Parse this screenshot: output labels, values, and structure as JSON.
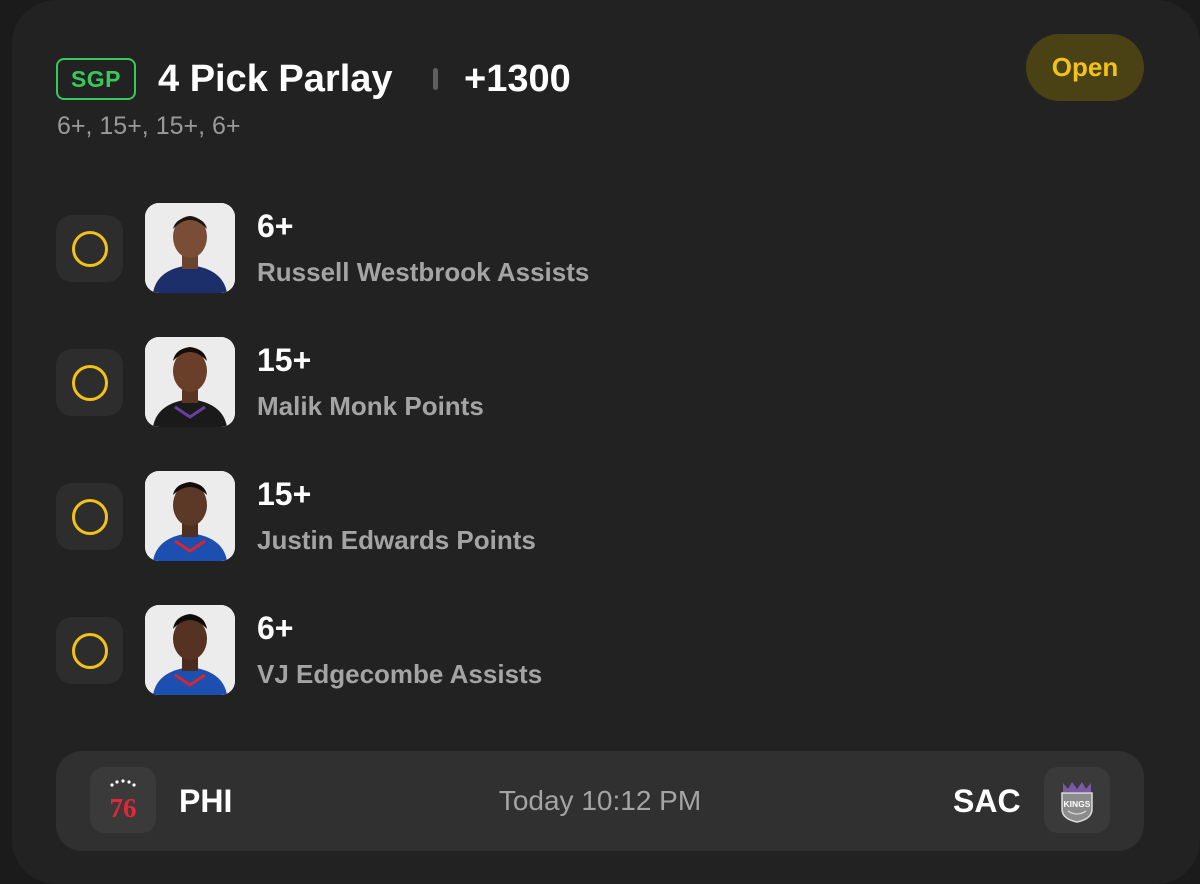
{
  "header": {
    "badge": "SGP",
    "title": "4 Pick Parlay",
    "odds": "+1300",
    "subtitle": "6+, 15+, 15+, 6+",
    "status": "Open"
  },
  "legs": [
    {
      "line": "6+",
      "market": "Russell Westbrook Assists",
      "jersey": "#1d2f6b",
      "avatar": "player-headshot"
    },
    {
      "line": "15+",
      "market": "Malik Monk Points",
      "jersey": "#1a1a1a",
      "avatar": "player-headshot"
    },
    {
      "line": "15+",
      "market": "Justin Edwards Points",
      "jersey": "#1d4fb0",
      "avatar": "player-headshot"
    },
    {
      "line": "6+",
      "market": "VJ Edgecombe Assists",
      "jersey": "#1d4fb0",
      "avatar": "player-headshot"
    }
  ],
  "game": {
    "away": {
      "abbr": "PHI",
      "logo": "76ers-logo",
      "logo_text": "76"
    },
    "time": "Today 10:12 PM",
    "home": {
      "abbr": "SAC",
      "logo": "kings-logo",
      "logo_text": "KINGS"
    }
  },
  "colors": {
    "accent": "#f2c218",
    "sgp_green": "#38c95a",
    "card_bg": "#222222"
  }
}
